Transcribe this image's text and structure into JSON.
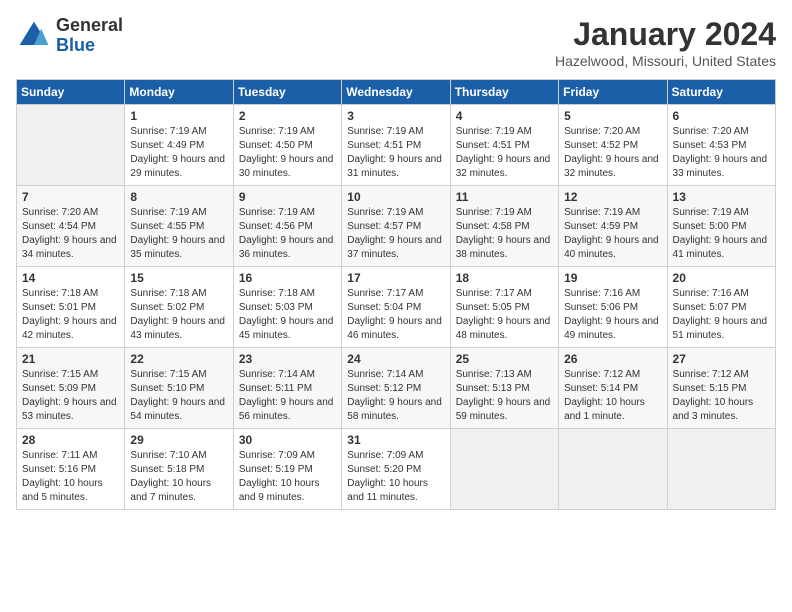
{
  "logo": {
    "general": "General",
    "blue": "Blue"
  },
  "title": "January 2024",
  "location": "Hazelwood, Missouri, United States",
  "days_header": [
    "Sunday",
    "Monday",
    "Tuesday",
    "Wednesday",
    "Thursday",
    "Friday",
    "Saturday"
  ],
  "weeks": [
    [
      {
        "day": "",
        "sunrise": "",
        "sunset": "",
        "daylight": ""
      },
      {
        "day": "1",
        "sunrise": "Sunrise: 7:19 AM",
        "sunset": "Sunset: 4:49 PM",
        "daylight": "Daylight: 9 hours and 29 minutes."
      },
      {
        "day": "2",
        "sunrise": "Sunrise: 7:19 AM",
        "sunset": "Sunset: 4:50 PM",
        "daylight": "Daylight: 9 hours and 30 minutes."
      },
      {
        "day": "3",
        "sunrise": "Sunrise: 7:19 AM",
        "sunset": "Sunset: 4:51 PM",
        "daylight": "Daylight: 9 hours and 31 minutes."
      },
      {
        "day": "4",
        "sunrise": "Sunrise: 7:19 AM",
        "sunset": "Sunset: 4:51 PM",
        "daylight": "Daylight: 9 hours and 32 minutes."
      },
      {
        "day": "5",
        "sunrise": "Sunrise: 7:20 AM",
        "sunset": "Sunset: 4:52 PM",
        "daylight": "Daylight: 9 hours and 32 minutes."
      },
      {
        "day": "6",
        "sunrise": "Sunrise: 7:20 AM",
        "sunset": "Sunset: 4:53 PM",
        "daylight": "Daylight: 9 hours and 33 minutes."
      }
    ],
    [
      {
        "day": "7",
        "sunrise": "Sunrise: 7:20 AM",
        "sunset": "Sunset: 4:54 PM",
        "daylight": "Daylight: 9 hours and 34 minutes."
      },
      {
        "day": "8",
        "sunrise": "Sunrise: 7:19 AM",
        "sunset": "Sunset: 4:55 PM",
        "daylight": "Daylight: 9 hours and 35 minutes."
      },
      {
        "day": "9",
        "sunrise": "Sunrise: 7:19 AM",
        "sunset": "Sunset: 4:56 PM",
        "daylight": "Daylight: 9 hours and 36 minutes."
      },
      {
        "day": "10",
        "sunrise": "Sunrise: 7:19 AM",
        "sunset": "Sunset: 4:57 PM",
        "daylight": "Daylight: 9 hours and 37 minutes."
      },
      {
        "day": "11",
        "sunrise": "Sunrise: 7:19 AM",
        "sunset": "Sunset: 4:58 PM",
        "daylight": "Daylight: 9 hours and 38 minutes."
      },
      {
        "day": "12",
        "sunrise": "Sunrise: 7:19 AM",
        "sunset": "Sunset: 4:59 PM",
        "daylight": "Daylight: 9 hours and 40 minutes."
      },
      {
        "day": "13",
        "sunrise": "Sunrise: 7:19 AM",
        "sunset": "Sunset: 5:00 PM",
        "daylight": "Daylight: 9 hours and 41 minutes."
      }
    ],
    [
      {
        "day": "14",
        "sunrise": "Sunrise: 7:18 AM",
        "sunset": "Sunset: 5:01 PM",
        "daylight": "Daylight: 9 hours and 42 minutes."
      },
      {
        "day": "15",
        "sunrise": "Sunrise: 7:18 AM",
        "sunset": "Sunset: 5:02 PM",
        "daylight": "Daylight: 9 hours and 43 minutes."
      },
      {
        "day": "16",
        "sunrise": "Sunrise: 7:18 AM",
        "sunset": "Sunset: 5:03 PM",
        "daylight": "Daylight: 9 hours and 45 minutes."
      },
      {
        "day": "17",
        "sunrise": "Sunrise: 7:17 AM",
        "sunset": "Sunset: 5:04 PM",
        "daylight": "Daylight: 9 hours and 46 minutes."
      },
      {
        "day": "18",
        "sunrise": "Sunrise: 7:17 AM",
        "sunset": "Sunset: 5:05 PM",
        "daylight": "Daylight: 9 hours and 48 minutes."
      },
      {
        "day": "19",
        "sunrise": "Sunrise: 7:16 AM",
        "sunset": "Sunset: 5:06 PM",
        "daylight": "Daylight: 9 hours and 49 minutes."
      },
      {
        "day": "20",
        "sunrise": "Sunrise: 7:16 AM",
        "sunset": "Sunset: 5:07 PM",
        "daylight": "Daylight: 9 hours and 51 minutes."
      }
    ],
    [
      {
        "day": "21",
        "sunrise": "Sunrise: 7:15 AM",
        "sunset": "Sunset: 5:09 PM",
        "daylight": "Daylight: 9 hours and 53 minutes."
      },
      {
        "day": "22",
        "sunrise": "Sunrise: 7:15 AM",
        "sunset": "Sunset: 5:10 PM",
        "daylight": "Daylight: 9 hours and 54 minutes."
      },
      {
        "day": "23",
        "sunrise": "Sunrise: 7:14 AM",
        "sunset": "Sunset: 5:11 PM",
        "daylight": "Daylight: 9 hours and 56 minutes."
      },
      {
        "day": "24",
        "sunrise": "Sunrise: 7:14 AM",
        "sunset": "Sunset: 5:12 PM",
        "daylight": "Daylight: 9 hours and 58 minutes."
      },
      {
        "day": "25",
        "sunrise": "Sunrise: 7:13 AM",
        "sunset": "Sunset: 5:13 PM",
        "daylight": "Daylight: 9 hours and 59 minutes."
      },
      {
        "day": "26",
        "sunrise": "Sunrise: 7:12 AM",
        "sunset": "Sunset: 5:14 PM",
        "daylight": "Daylight: 10 hours and 1 minute."
      },
      {
        "day": "27",
        "sunrise": "Sunrise: 7:12 AM",
        "sunset": "Sunset: 5:15 PM",
        "daylight": "Daylight: 10 hours and 3 minutes."
      }
    ],
    [
      {
        "day": "28",
        "sunrise": "Sunrise: 7:11 AM",
        "sunset": "Sunset: 5:16 PM",
        "daylight": "Daylight: 10 hours and 5 minutes."
      },
      {
        "day": "29",
        "sunrise": "Sunrise: 7:10 AM",
        "sunset": "Sunset: 5:18 PM",
        "daylight": "Daylight: 10 hours and 7 minutes."
      },
      {
        "day": "30",
        "sunrise": "Sunrise: 7:09 AM",
        "sunset": "Sunset: 5:19 PM",
        "daylight": "Daylight: 10 hours and 9 minutes."
      },
      {
        "day": "31",
        "sunrise": "Sunrise: 7:09 AM",
        "sunset": "Sunset: 5:20 PM",
        "daylight": "Daylight: 10 hours and 11 minutes."
      },
      {
        "day": "",
        "sunrise": "",
        "sunset": "",
        "daylight": ""
      },
      {
        "day": "",
        "sunrise": "",
        "sunset": "",
        "daylight": ""
      },
      {
        "day": "",
        "sunrise": "",
        "sunset": "",
        "daylight": ""
      }
    ]
  ]
}
